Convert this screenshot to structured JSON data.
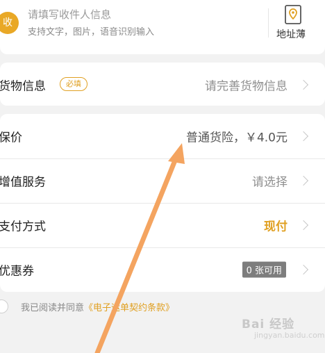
{
  "receiver": {
    "badge": "收",
    "title": "请填写收件人信息",
    "subtitle": "支持文字，图片，语音识别输入",
    "address_book_label": "地址薄"
  },
  "goods": {
    "label": "货物信息",
    "required_tag": "必填",
    "value": "请完善货物信息"
  },
  "options": [
    {
      "label": "保价",
      "value": "普通货险，￥4.0元"
    },
    {
      "label": "增值服务",
      "value": "请选择"
    },
    {
      "label": "支付方式",
      "value": "现付"
    },
    {
      "label": "优惠券",
      "value": "0 张可用"
    }
  ],
  "agreement": {
    "prefix": "我已阅读并同意",
    "link": "《电子运单契约条款》"
  },
  "watermark": {
    "text": "Bai 经验",
    "sub": "jingyan.baidu.com"
  },
  "colors": {
    "accent": "#e0a022",
    "annotation_arrow": "#f4a460"
  }
}
